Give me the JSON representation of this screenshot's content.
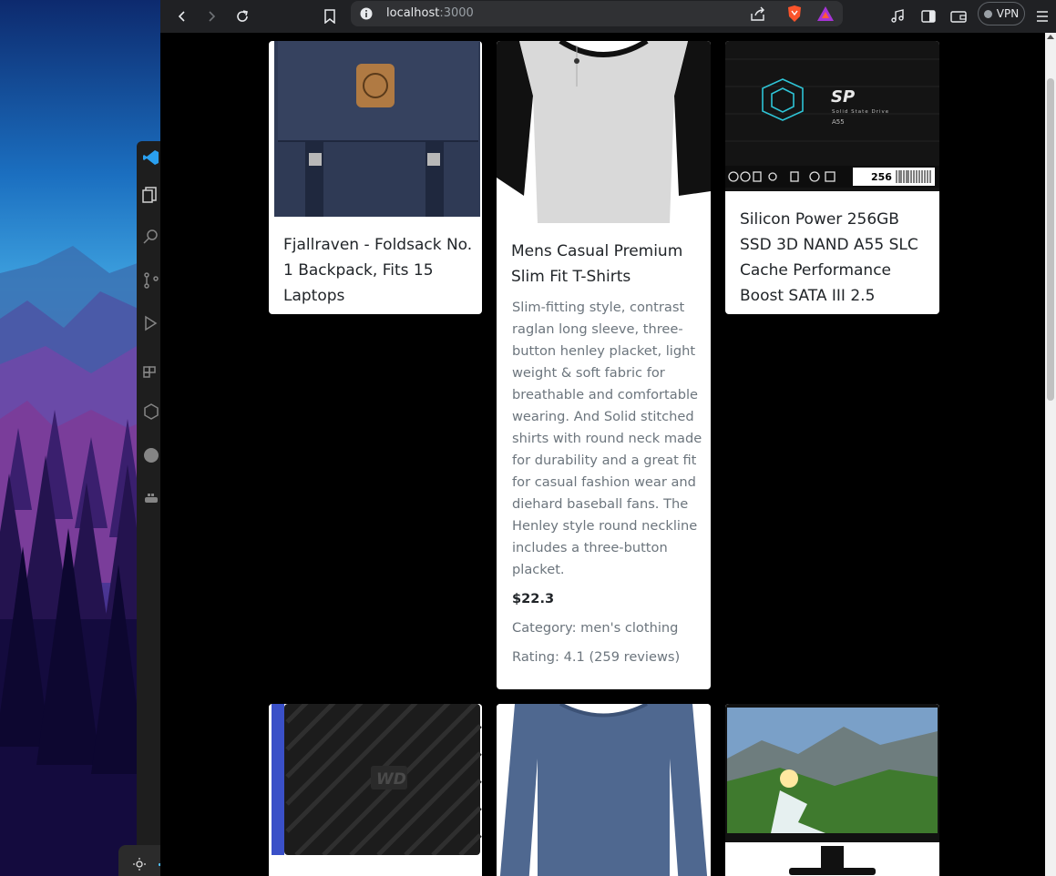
{
  "browser": {
    "url_host": "localhost",
    "url_port": ":3000",
    "vpn_label": "VPN"
  },
  "products": [
    {
      "title": "Fjallraven - Foldsack No. 1 Backpack, Fits 15 Laptops",
      "title_lines": [
        "Fjallraven - Foldsack No.",
        "1 Backpack, Fits 15",
        "Laptops"
      ]
    },
    {
      "title_lines": [
        "Mens Casual Premium",
        "Slim Fit T-Shirts"
      ],
      "description_lines": [
        "Slim-fitting style, contrast",
        "raglan long sleeve, three-",
        "button henley placket, light",
        "weight & soft fabric for",
        "breathable and comfortable",
        "wearing. And Solid stitched",
        "shirts with round neck made",
        "for durability and a great fit",
        "for casual fashion wear and",
        "diehard baseball fans. The",
        "Henley style round neckline",
        "includes a three-button",
        "placket."
      ],
      "price": "$22.3",
      "category": "Category: men's clothing",
      "rating": "Rating: 4.1 (259 reviews)"
    },
    {
      "title_lines": [
        "Silicon Power 256GB",
        "SSD 3D NAND A55 SLC",
        "Cache Performance",
        "Boost SATA III 2.5"
      ],
      "image_text": {
        "brand": "SP",
        "subtitle": "Solid State Drive",
        "model": "A55",
        "capacity": "256"
      }
    },
    {
      "image_text": {
        "brand": "WD"
      }
    },
    {},
    {}
  ],
  "brightness": {
    "level": 0.4
  }
}
